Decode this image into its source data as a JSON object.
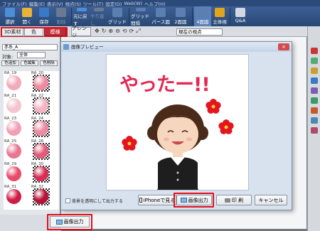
{
  "menu": [
    "ファイル(F)",
    "編集(E)",
    "表示(V)",
    "視点(S)",
    "ツール(T)",
    "設定(D)",
    "Web(W)",
    "ヘルプ(H)"
  ],
  "toolbar": [
    {
      "label": "選択",
      "icon": "cursor-icon",
      "color": "#4d8fd6"
    },
    {
      "label": "開く",
      "icon": "folder-open-icon",
      "color": "#e8b33a"
    },
    {
      "label": "保存",
      "icon": "save-icon",
      "color": "#3a78c8"
    },
    {
      "label": "削除",
      "icon": "delete-icon",
      "color": "#6a7a92",
      "dim": true
    },
    {
      "label": "元に戻す",
      "icon": "undo-icon",
      "color": "#4d8fd6"
    },
    {
      "label": "やり直し",
      "icon": "redo-icon",
      "color": "#6a7a92",
      "dim": true
    },
    {
      "label": "グリッド",
      "icon": "grid-icon",
      "color": "#5a7fb0"
    },
    {
      "label": "グリッド間隔",
      "icon": "grid-spacing-icon",
      "color": "#5a7fb0"
    },
    {
      "label": "パース図",
      "icon": "perspective-icon",
      "color": "#5a7fb0"
    },
    {
      "label": "2面図",
      "icon": "two-view-icon",
      "color": "#5a7fb0"
    },
    {
      "label": "4面図",
      "icon": "four-view-icon",
      "color": "#5a7fb0",
      "active": true
    },
    {
      "label": "立体視",
      "icon": "3d-icon",
      "color": "#e0a51c"
    },
    {
      "label": "Q&A",
      "icon": "qa-icon",
      "color": "#d2d8e2"
    }
  ],
  "tabs": {
    "material": "3D素材",
    "color": "色",
    "pattern": "模様",
    "arrange": "アレンジ"
  },
  "view_select": "現在の視点",
  "left_panel": {
    "title": "赤系_A",
    "target_label": "対象:",
    "target_value": "全体",
    "buttons": [
      "色追加",
      "色編集",
      "色削除"
    ],
    "swatches": [
      {
        "label": "RA_19",
        "color": "#f2a9b8",
        "checker": false
      },
      {
        "label": "RA_20",
        "color": "#ee8ba0",
        "checker": true
      },
      {
        "label": "RA_21",
        "color": "#f5c4cf",
        "checker": false
      },
      {
        "label": "RA_22",
        "color": "#f3b5c3",
        "checker": true
      },
      {
        "label": "RA_23",
        "color": "#f0a0b4",
        "checker": false
      },
      {
        "label": "RA_24",
        "color": "#ec8aa2",
        "checker": true
      },
      {
        "label": "RA_25",
        "color": "#e9758f",
        "checker": false
      },
      {
        "label": "RA_26",
        "color": "#e25c7a",
        "checker": true
      },
      {
        "label": "RA_29",
        "color": "#e84a6a",
        "checker": false
      },
      {
        "label": "RA_30",
        "color": "#d82e55",
        "checker": true
      },
      {
        "label": "RA_31",
        "color": "#d01c45",
        "checker": false
      },
      {
        "label": "RA_32",
        "color": "#b8123a",
        "checker": true
      }
    ]
  },
  "bottom": {
    "image_output": "画像出力"
  },
  "dialog": {
    "title": "画像プレビュー",
    "close": "×",
    "headline": "やったー!!",
    "checkbox_label": "背景を透明にして出力する",
    "buttons": {
      "iphone": "iPhoneで見る",
      "output": "画像出力",
      "print": "印 刷",
      "cancel": "キャンセル"
    }
  },
  "accent": {
    "red": "#e0101c",
    "headline": "#e22a55",
    "flower": "#e3161f"
  }
}
